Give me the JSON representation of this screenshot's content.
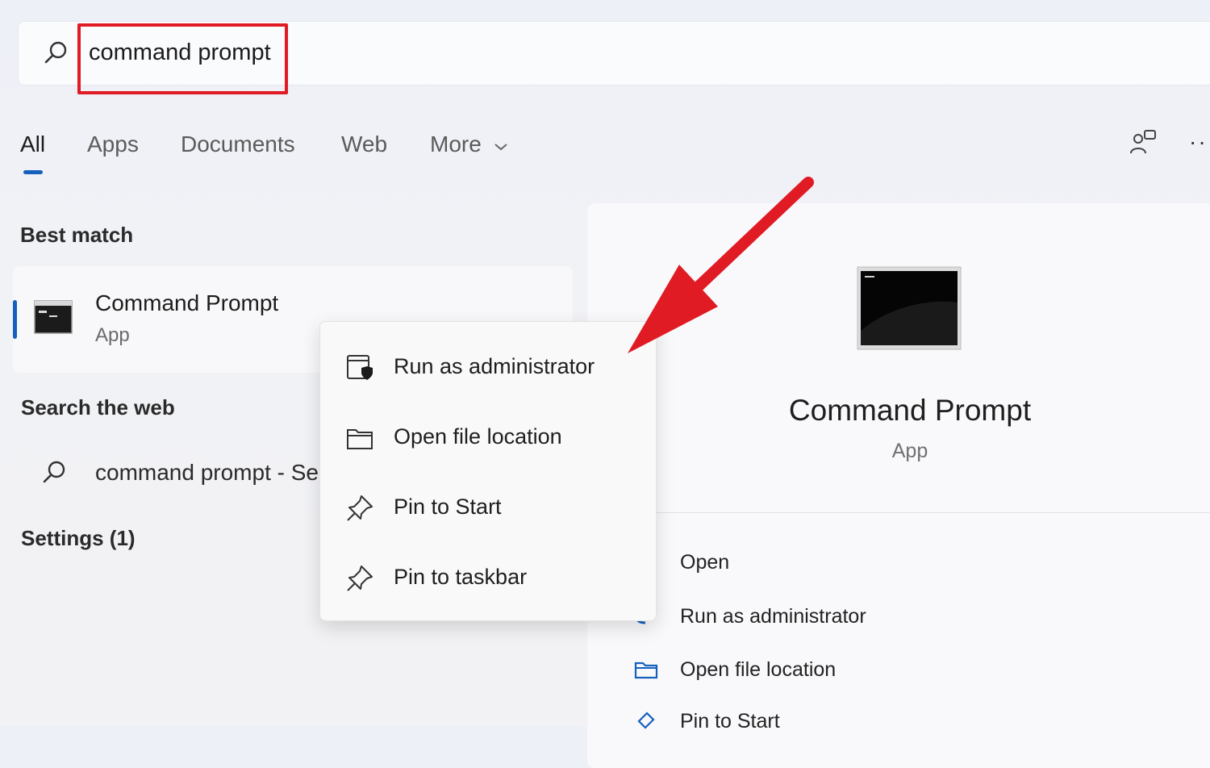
{
  "search": {
    "value": "command prompt"
  },
  "tabs": [
    {
      "label": "All"
    },
    {
      "label": "Apps"
    },
    {
      "label": "Documents"
    },
    {
      "label": "Web"
    },
    {
      "label": "More"
    }
  ],
  "toolbar": {
    "more_options": "··"
  },
  "left": {
    "best_match_heading": "Best match",
    "best_match": {
      "title": "Command Prompt",
      "subtitle": "App"
    },
    "search_web_heading": "Search the web",
    "web_result": "command prompt - See web results",
    "settings_heading": "Settings (1)"
  },
  "context_menu": {
    "items": [
      {
        "label": "Run as administrator",
        "icon": "shield-app-icon"
      },
      {
        "label": "Open file location",
        "icon": "folder-icon"
      },
      {
        "label": "Pin to Start",
        "icon": "pin-icon"
      },
      {
        "label": "Pin to taskbar",
        "icon": "pin-icon"
      }
    ]
  },
  "detail": {
    "title": "Command Prompt",
    "subtitle": "App",
    "actions": [
      {
        "label": "Open"
      },
      {
        "label": "Run as administrator"
      },
      {
        "label": "Open file location"
      },
      {
        "label": "Pin to Start"
      }
    ]
  },
  "colors": {
    "accent": "#1560bd",
    "highlight_red": "#e01b24"
  }
}
